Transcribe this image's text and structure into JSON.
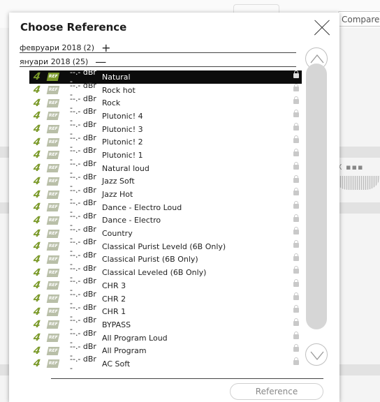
{
  "background": {
    "compare_label": "Compare",
    "slider_text": "X ▪▪▪"
  },
  "dialog": {
    "title": "Choose Reference",
    "groups": [
      {
        "label": "февруари 2018",
        "count": "(2)",
        "toggle": "+"
      },
      {
        "label": "януари 2018",
        "count": "(25)",
        "toggle": "—"
      }
    ],
    "rows": [
      {
        "level": "--.- dBr -",
        "name": "Natural",
        "selected": true
      },
      {
        "level": "--.- dBr -",
        "name": "Rock hot"
      },
      {
        "level": "--.- dBr -",
        "name": "Rock"
      },
      {
        "level": "--.- dBr -",
        "name": "Plutonic! 4"
      },
      {
        "level": "--.- dBr -",
        "name": "Plutonic! 3"
      },
      {
        "level": "--.- dBr -",
        "name": "Plutonic! 2"
      },
      {
        "level": "--.- dBr -",
        "name": "Plutonic! 1"
      },
      {
        "level": "--.- dBr -",
        "name": "Natural loud"
      },
      {
        "level": "--.- dBr -",
        "name": "Jazz Soft"
      },
      {
        "level": "--.- dBr -",
        "name": "Jazz Hot"
      },
      {
        "level": "--.- dBr -",
        "name": "Dance - Electro Loud"
      },
      {
        "level": "--.- dBr -",
        "name": "Dance - Electro"
      },
      {
        "level": "--.- dBr -",
        "name": "Country"
      },
      {
        "level": "--.- dBr -",
        "name": "Classical Purist Leveld (6B Only)"
      },
      {
        "level": "--.- dBr -",
        "name": "Classical Purist (6B Only)"
      },
      {
        "level": "--.- dBr -",
        "name": "Classical Leveled (6B Only)"
      },
      {
        "level": "--.- dBr -",
        "name": "CHR 3"
      },
      {
        "level": "--.- dBr -",
        "name": "CHR 2"
      },
      {
        "level": "--.- dBr -",
        "name": "CHR 1"
      },
      {
        "level": "--.- dBr -",
        "name": "BYPASS"
      },
      {
        "level": "--.- dBr -",
        "name": "All Program Loud"
      },
      {
        "level": "--.- dBr -",
        "name": "All Program"
      },
      {
        "level": "--.- dBr -",
        "name": "AC Soft"
      }
    ],
    "icons": {
      "g": "4",
      "ref": "REF",
      "lock": "lock-icon"
    },
    "reference_button": "Reference"
  },
  "colors": {
    "accent": "#7b9a2a",
    "selected_bg": "#0c0c0c"
  }
}
